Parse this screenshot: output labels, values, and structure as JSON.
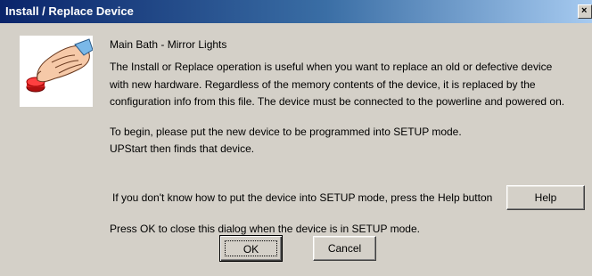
{
  "window": {
    "title": "Install / Replace Device",
    "close_glyph": "×"
  },
  "icon": {
    "name": "hand-pressing-button-icon"
  },
  "content": {
    "device_name": "Main Bath - Mirror Lights",
    "description_lines": [
      "The Install or Replace operation is useful when you want to replace an old or defective device",
      "with new hardware.  Regardless of the memory contents of the device, it is replaced by the",
      "configuration info from this file.  The device must be connected to the powerline and powered on."
    ],
    "begin_lines": [
      "To begin, please put the new device to be programmed into SETUP mode.",
      "UPStart then finds that device."
    ],
    "help_prompt": "If you don't know how to put the device into SETUP mode, press the Help button",
    "close_instruction": "Press OK to close this dialog when the device is in SETUP mode."
  },
  "buttons": {
    "help": "Help",
    "ok": "OK",
    "cancel": "Cancel"
  },
  "colors": {
    "titlebar_start": "#0a246a",
    "titlebar_end": "#a6caf0",
    "dialog_bg": "#d4d0c8"
  }
}
